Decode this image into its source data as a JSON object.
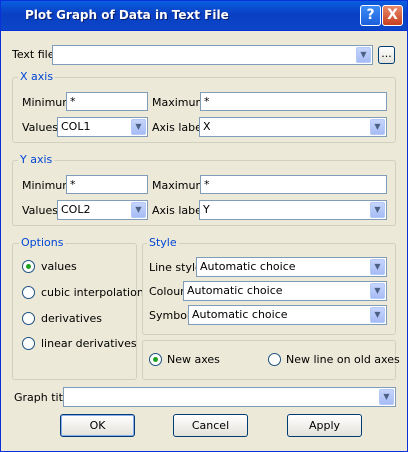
{
  "window": {
    "title": "Plot Graph of Data in Text File",
    "help_glyph": "?",
    "close_glyph": "X"
  },
  "textfile": {
    "label": "Text file",
    "value": "",
    "browse_label": "..."
  },
  "xaxis": {
    "group_label": "X axis",
    "minimum_label": "Minimum",
    "minimum_value": "*",
    "maximum_label": "Maximum",
    "maximum_value": " *",
    "values_label": "Values",
    "values_value": "COL1",
    "axislabel_label": "Axis label",
    "axislabel_value": "X"
  },
  "yaxis": {
    "group_label": "Y axis",
    "minimum_label": "Minimum",
    "minimum_value": "*",
    "maximum_label": "Maximum",
    "maximum_value": "*",
    "values_label": "Values",
    "values_value": "COL2",
    "axislabel_label": "Axis label",
    "axislabel_value": "Y"
  },
  "options": {
    "group_label": "Options",
    "items": [
      {
        "label": "values",
        "selected": true
      },
      {
        "label": "cubic interpolation",
        "selected": false
      },
      {
        "label": "derivatives",
        "selected": false
      },
      {
        "label": "linear derivatives",
        "selected": false
      }
    ]
  },
  "style": {
    "group_label": "Style",
    "linestyle_label": "Line style",
    "linestyle_value": "Automatic choice",
    "colour_label": "Colour",
    "colour_value": "Automatic choice",
    "symbol_label": "Symbol",
    "symbol_value": "Automatic choice"
  },
  "axes_mode": {
    "new_axes_label": "New axes",
    "new_axes_selected": true,
    "new_line_label": "New line on old axes",
    "new_line_selected": false
  },
  "graph_title": {
    "label": "Graph title",
    "value": ""
  },
  "buttons": {
    "ok": "OK",
    "cancel": "Cancel",
    "apply": "Apply"
  },
  "icons": {
    "dropdown_arrow": "▼"
  }
}
